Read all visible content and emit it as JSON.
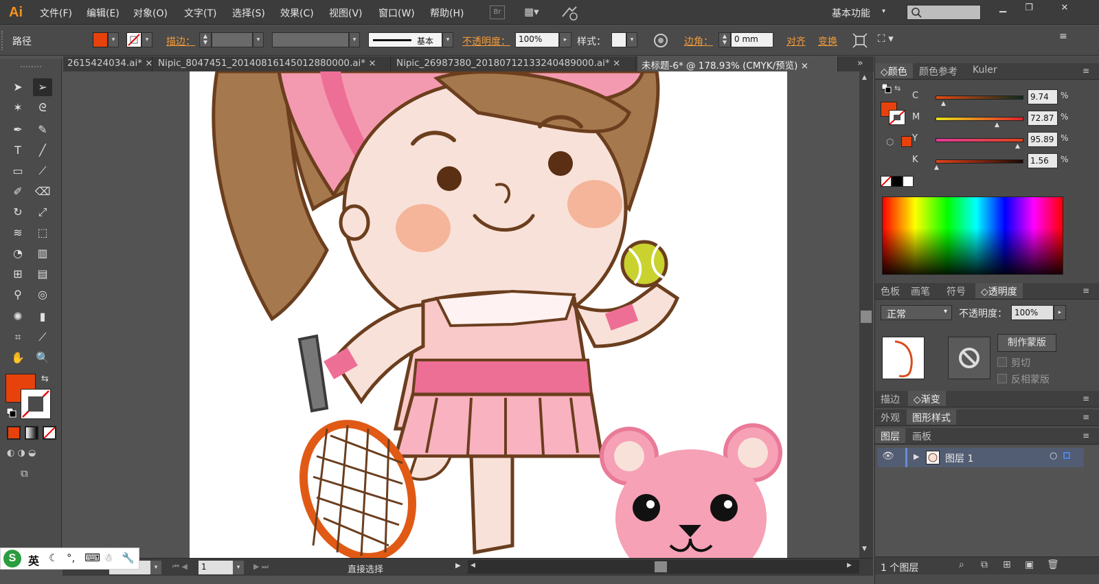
{
  "app": {
    "logo": "Ai"
  },
  "menu": [
    "文件(F)",
    "编辑(E)",
    "对象(O)",
    "文字(T)",
    "选择(S)",
    "效果(C)",
    "视图(V)",
    "窗口(W)",
    "帮助(H)"
  ],
  "menu_br_label": "Br",
  "workspace": {
    "label": "基本功能",
    "search_placeholder": ""
  },
  "control": {
    "object_type": "路径",
    "stroke_label": "描边：",
    "stroke_style": "基本",
    "opacity_label": "不透明度：",
    "opacity_value": "100%",
    "style_label": "样式：",
    "corner_label": "边角：",
    "corner_value": "0 mm",
    "align_label": "对齐",
    "transform_label": "变换",
    "fill_color": "#e8420c"
  },
  "tabs": [
    {
      "label": "2615424034.ai*",
      "active": false
    },
    {
      "label": "Nipic_8047451_20140816145012880000.ai*",
      "active": false
    },
    {
      "label": "Nipic_26987380_20180712133240489000.ai*",
      "active": false
    },
    {
      "label": "未标题-6* @ 178.93% (CMYK/预览)",
      "active": true
    }
  ],
  "tab_close": "×",
  "tab_overflow": "»",
  "status": {
    "zoom": "178.93",
    "page": "1",
    "tool": "直接选择"
  },
  "color_panel": {
    "tabs": [
      "颜色",
      "颜色参考",
      "Kuler"
    ],
    "channels": [
      {
        "name": "C",
        "value": "9.74",
        "pos": 0.0974
      },
      {
        "name": "M",
        "value": "72.87",
        "pos": 0.7287
      },
      {
        "name": "Y",
        "value": "95.89",
        "pos": 0.9589
      },
      {
        "name": "K",
        "value": "1.56",
        "pos": 0.0156
      }
    ],
    "unit": "%"
  },
  "transparency_panel": {
    "tabs": [
      "色板",
      "画笔",
      "符号",
      "透明度"
    ],
    "blend_mode": "正常",
    "opacity_label": "不透明度：",
    "opacity_value": "100%",
    "make_mask": "制作蒙版",
    "clip": "剪切",
    "invert": "反相蒙版"
  },
  "stroke_gradient_tabs": [
    "描边",
    "渐变"
  ],
  "appearance_tabs": [
    "外观",
    "图形样式"
  ],
  "layers_panel": {
    "tabs": [
      "图层",
      "画板"
    ],
    "layer_name": "图层 1",
    "count": "1 个图层"
  },
  "ime": {
    "lang": "英"
  },
  "colors": {
    "accent": "#f39b3a",
    "fill": "#e8420c"
  }
}
